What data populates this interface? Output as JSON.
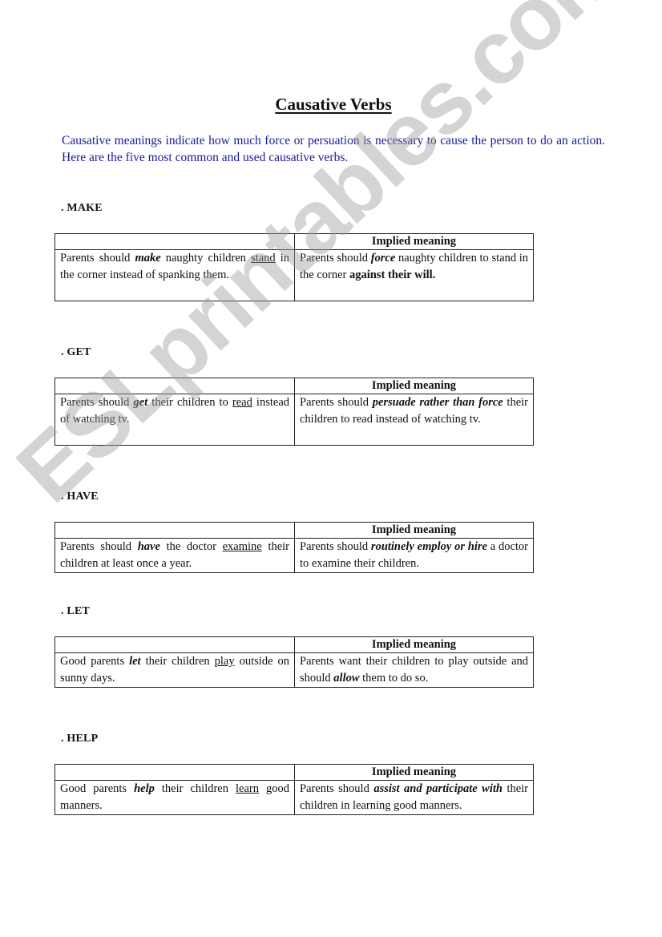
{
  "title": "Causative Verbs",
  "intro": "Causative meanings indicate how much force or persuation is necessary to cause the person to do an action. Here are the five most common and used causative verbs.",
  "watermark": "ESLprintables.com",
  "colors": {
    "intro_text": "#1a1a9c",
    "watermark": "#cccccc"
  },
  "sections": [
    {
      "label": ". MAKE",
      "header": [
        "",
        "Implied meaning"
      ],
      "example": [
        {
          "t": "Parents should "
        },
        {
          "t": "make",
          "s": "kw"
        },
        {
          "t": " naughty children "
        },
        {
          "t": "stand",
          "s": "ul"
        },
        {
          "t": " in the corner instead of spanking them."
        }
      ],
      "meaning": [
        {
          "t": "Parents should "
        },
        {
          "t": "force",
          "s": "kw"
        },
        {
          "t": " naughty children to stand in the corner "
        },
        {
          "t": "against their will.",
          "s": "b"
        }
      ]
    },
    {
      "label": ". GET",
      "header": [
        "",
        "Implied meaning"
      ],
      "example": [
        {
          "t": "Parents should "
        },
        {
          "t": "get",
          "s": "kw"
        },
        {
          "t": " their children to "
        },
        {
          "t": "read",
          "s": "ul"
        },
        {
          "t": " instead of watching tv."
        }
      ],
      "meaning": [
        {
          "t": "Parents should "
        },
        {
          "t": "persuade rather than force",
          "s": "kw"
        },
        {
          "t": " their children to read instead of watching tv."
        }
      ]
    },
    {
      "label": ". HAVE",
      "header": [
        "",
        "Implied meaning"
      ],
      "example": [
        {
          "t": "Parents should "
        },
        {
          "t": "have",
          "s": "kw"
        },
        {
          "t": " the doctor "
        },
        {
          "t": "examine",
          "s": "ul"
        },
        {
          "t": " their children at least once a year."
        }
      ],
      "meaning": [
        {
          "t": "Parents should "
        },
        {
          "t": "routinely employ or hire",
          "s": "kw"
        },
        {
          "t": " a doctor to examine their children."
        }
      ]
    },
    {
      "label": ". LET",
      "header": [
        "",
        "Implied meaning"
      ],
      "example": [
        {
          "t": "Good parents "
        },
        {
          "t": "let",
          "s": "kw"
        },
        {
          "t": " their children "
        },
        {
          "t": "play",
          "s": "ul"
        },
        {
          "t": " outside on sunny days."
        }
      ],
      "meaning": [
        {
          "t": "Parents want their children to play outside and should "
        },
        {
          "t": "allow",
          "s": "kw"
        },
        {
          "t": " them to do so."
        }
      ]
    },
    {
      "label": ". HELP",
      "header": [
        "",
        "Implied meaning"
      ],
      "example": [
        {
          "t": "Good parents "
        },
        {
          "t": "help",
          "s": "kw"
        },
        {
          "t": " their children "
        },
        {
          "t": "learn",
          "s": "ul"
        },
        {
          "t": " good manners."
        }
      ],
      "meaning": [
        {
          "t": "Parents should "
        },
        {
          "t": "assist and participate with",
          "s": "kw"
        },
        {
          "t": " their children in learning good manners."
        }
      ]
    }
  ]
}
